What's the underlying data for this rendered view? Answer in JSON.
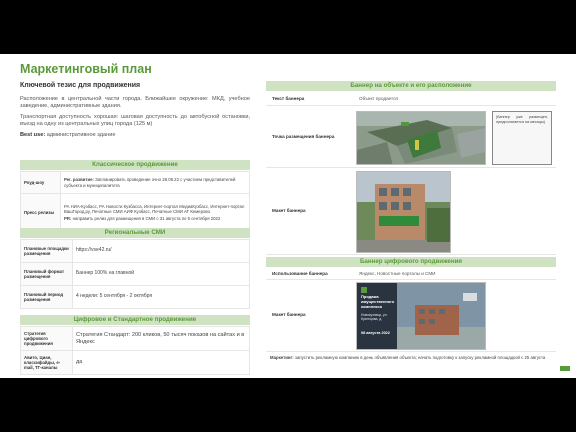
{
  "title": "Маркетинговый план",
  "left": {
    "heading": "Ключевой тезис для продвижения",
    "para1": "Расположение в центральной части города. Ближайшее окружение: МКД, учебное заведение, административные здания.",
    "para2": "Транспортная доступность хорошая: шаговая доступность до автобусной остановки, въезд на одну из центральных улиц города (125 м)",
    "best_use_label": "Best use:",
    "best_use_value": "административное здание",
    "classic": {
      "header": "Классическое продвижение",
      "rows": [
        {
          "k": "Роуд-шоу",
          "v_bold": "Рег. развитие:",
          "v": "Запланировать проведение очно 28.09.22 с участием представителей субъекта и муниципалитета"
        },
        {
          "k": "Пресс релизы",
          "v": "РА НИА-Кузбасс, РА Новости Кузбасса, Интернет-портал МедиаКузбасс, Интернет-портал ВашГород.ру, Печатные СМИ АИФ Кузбасс, Печатные СМИ АТ Кемерово",
          "v2_bold": "PR:",
          "v2": "направить релиз для размещения в СМИ с 31 августа по 5 сентября 2022"
        }
      ]
    },
    "regional": {
      "header": "Региональные СМИ",
      "rows": [
        {
          "k": "Плановые площадки размещения",
          "v": "https://vse42.ru/"
        },
        {
          "k": "Плановый формат размещения",
          "v": "Баннер 100% на главной"
        },
        {
          "k": "Плановый период размещения",
          "v": "4 недели: 5 сентября - 2 октября"
        }
      ]
    },
    "digital": {
      "header": "Цифровое и Стандартное продвижение",
      "rows": [
        {
          "k": "Стратегия цифрового продвижения",
          "v": "Стратегия Стандарт: 200 кликов, 50 тысяч показов на сайтах и в Яндекс"
        },
        {
          "k": "Авито, Циан, классифайды, e-mail, ТГ-каналы",
          "v": "да"
        }
      ]
    }
  },
  "right": {
    "banner_on_site": {
      "header": "Баннер на объекте и его расположение",
      "text_label": "Текст баннера",
      "text_value": "Объект продается",
      "place_label": "Точка размещения баннера",
      "banner_note": "(баннер уже размещен, предполагается на месяцы)",
      "mockup_label": "Макет баннера"
    },
    "digital_banner": {
      "header": "Баннер цифрового продвижения",
      "use_label": "Использование баннера",
      "use_value": "Яндекс, Новостные порталы и СМИ",
      "mockup_label": "Макет баннера",
      "ad_title": "Продажа имущественного комплекса",
      "ad_addr": "Новокузнецк, ул. Кузнецова, д.",
      "ad_date": "08 августа 2022",
      "footer_bold": "Маркетинг:",
      "footer": "запустить рекламную компанию в день объявления объекта; начать подготовку к запуску рекламной площадкой с 25 августа"
    }
  },
  "colors": {
    "accent": "#5b9a3a",
    "bar_bg": "#cfe3c2"
  }
}
